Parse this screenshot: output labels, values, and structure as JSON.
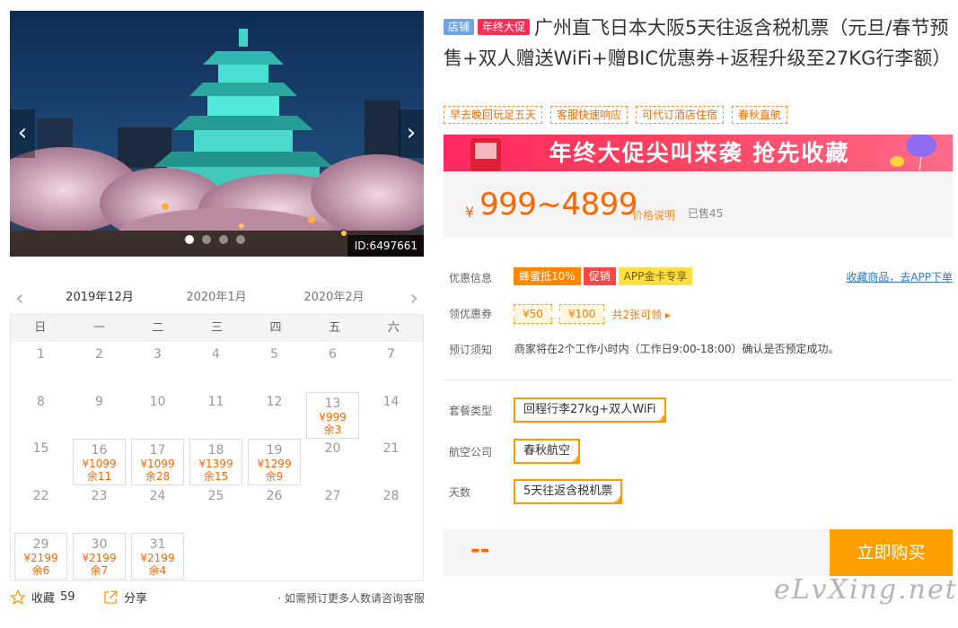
{
  "gallery": {
    "image_id": "ID:6497661",
    "slide_count": 4,
    "active_slide": 1
  },
  "calendar": {
    "months": [
      "2019年12月",
      "2020年1月",
      "2020年2月"
    ],
    "weekdays": [
      "日",
      "一",
      "二",
      "三",
      "四",
      "五",
      "六"
    ],
    "days": [
      {
        "d": "1"
      },
      {
        "d": "2"
      },
      {
        "d": "3"
      },
      {
        "d": "4"
      },
      {
        "d": "5"
      },
      {
        "d": "6"
      },
      {
        "d": "7"
      },
      {
        "d": "8"
      },
      {
        "d": "9"
      },
      {
        "d": "10"
      },
      {
        "d": "11"
      },
      {
        "d": "12"
      },
      {
        "d": "13",
        "price": "¥999",
        "left": "余3"
      },
      {
        "d": "14"
      },
      {
        "d": "15"
      },
      {
        "d": "16",
        "price": "¥1099",
        "left": "余11"
      },
      {
        "d": "17",
        "price": "¥1099",
        "left": "余28"
      },
      {
        "d": "18",
        "price": "¥1399",
        "left": "余15"
      },
      {
        "d": "19",
        "price": "¥1299",
        "left": "余9"
      },
      {
        "d": "20"
      },
      {
        "d": "21"
      },
      {
        "d": "22"
      },
      {
        "d": "23"
      },
      {
        "d": "24"
      },
      {
        "d": "25"
      },
      {
        "d": "26"
      },
      {
        "d": "27"
      },
      {
        "d": "28"
      },
      {
        "d": "29",
        "price": "¥2199",
        "left": "余6"
      },
      {
        "d": "30",
        "price": "¥2199",
        "left": "余7"
      },
      {
        "d": "31",
        "price": "¥2199",
        "left": "余4"
      }
    ]
  },
  "actions": {
    "favorite_label": "收藏",
    "favorite_count": "59",
    "share_label": "分享",
    "consult_text": "· 如需预订更多人数请咨询客服"
  },
  "product": {
    "tag_shop": "店铺",
    "tag_sale": "年终大促",
    "title": "广州直飞日本大阪5天往返含税机票（元旦/春节预售+双人赠送WiFi+赠BIC优惠券+返程升级至27KG行李额）",
    "features": [
      "早去晚回玩足五天",
      "客服快速响应",
      "可代订酒店住宿",
      "春秋直航"
    ],
    "banner_text": "年终大促尖叫来袭  抢先收藏",
    "price_currency": "¥",
    "price_range": "999~4899",
    "price_note": "价格说明",
    "sold": "已售45"
  },
  "promo": {
    "label": "优惠信息",
    "badges": [
      "蜂蜜抵10%",
      "促销",
      "APP金卡专享"
    ],
    "fav_app": "收藏商品，去APP下单"
  },
  "coupons": {
    "label": "领优惠券",
    "items": [
      "¥50",
      "¥100"
    ],
    "more": "共2张可领 ▸"
  },
  "booking": {
    "label": "预订须知",
    "text": "商家将在2个工作小时内（工作日9:00-18:00）确认是否预定成功。"
  },
  "options": {
    "package_label": "套餐类型",
    "package_value": "回程行李27kg+双人WiFi",
    "airline_label": "航空公司",
    "airline_value": "春秋航空",
    "days_label": "天数",
    "days_value": "5天往返含税机票"
  },
  "purchase": {
    "price": "--",
    "buy_label": "立即购买"
  },
  "watermark": "eLvXing.net",
  "colors": {
    "accent": "#ff9900",
    "price": "#ff6600",
    "sale_tag": "#ff2e54",
    "shop_tag": "#6fa3e7"
  }
}
